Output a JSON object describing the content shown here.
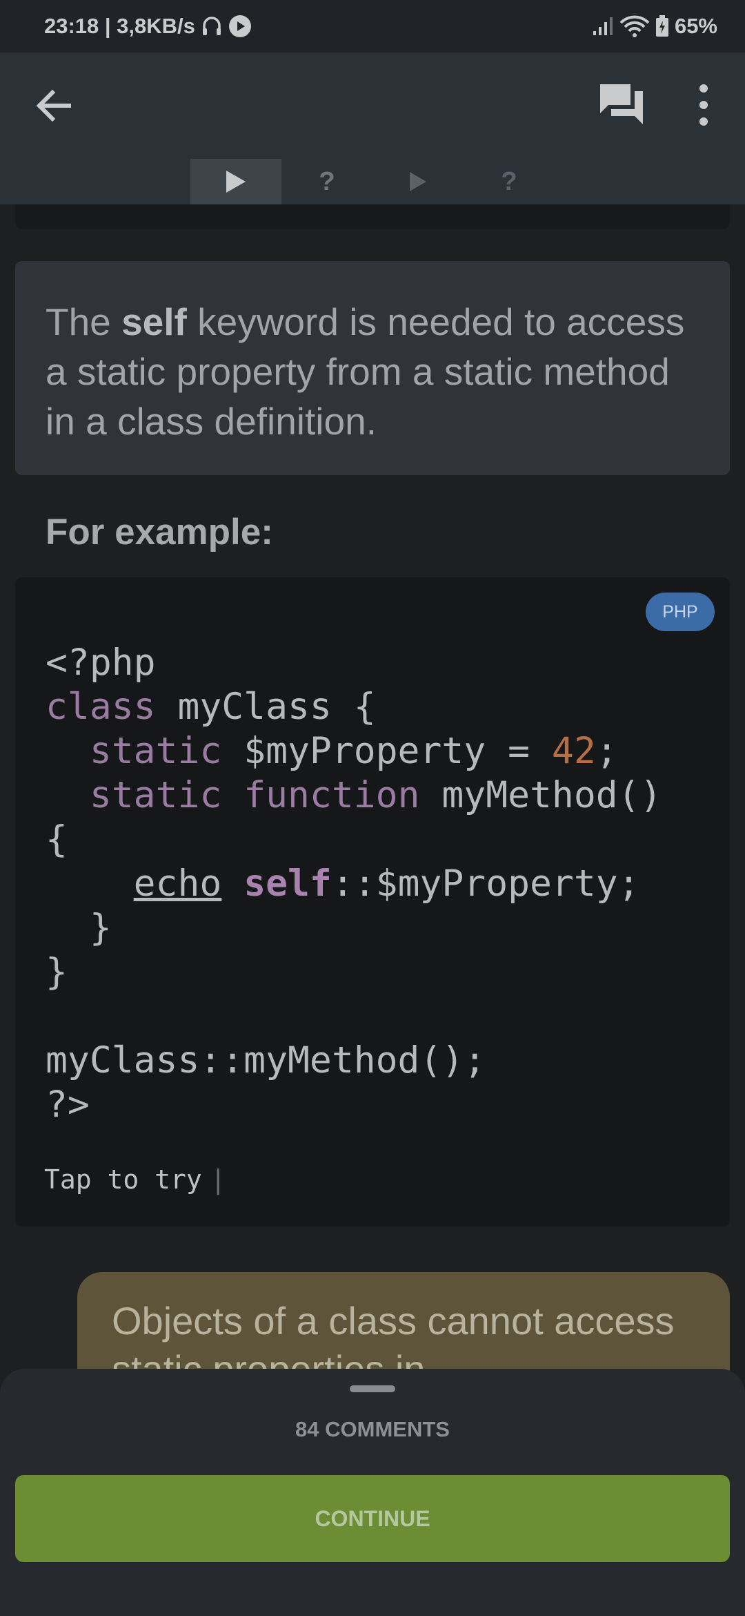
{
  "status_bar": {
    "time_speed": "23:18 | 3,8KB/s",
    "battery": "65%"
  },
  "app_bar": {
    "back_icon": "arrow-back-icon",
    "comments_icon": "chat-bubbles-icon",
    "more_icon": "more-vert-icon"
  },
  "tabs": [
    {
      "icon": "play-icon",
      "label": "",
      "active": true
    },
    {
      "icon": "question-icon",
      "label": "?",
      "active": false
    },
    {
      "icon": "play-icon",
      "label": "",
      "active": false
    },
    {
      "icon": "question-icon",
      "label": "?",
      "active": false
    }
  ],
  "lesson": {
    "info_pre": "The ",
    "info_bold": "self",
    "info_post": " keyword is needed to access a static property from a static method in a class definition.",
    "section_title": "For example:"
  },
  "code": {
    "language": "PHP",
    "line1": "<?php",
    "l2_kw": "class",
    "l2_rest": " myClass {",
    "l3_indent": "  ",
    "l3_kw": "static",
    "l3_mid": " $myProperty = ",
    "l3_num": "42",
    "l3_end": ";",
    "l4_indent": "  ",
    "l4_kw1": "static",
    "l4_sp": " ",
    "l4_kw2": "function",
    "l4_rest": " myMethod()",
    "line5": "{",
    "l6_indent": "    ",
    "l6_echo": "echo",
    "l6_sp": " ",
    "l6_self": "self",
    "l6_rest": "::$myProperty;",
    "line7": "  }",
    "line8": "}",
    "line9": "",
    "line10": "myClass::myMethod();",
    "line11": "?>",
    "tap_to_try": "Tap to try"
  },
  "answer": {
    "text": "Objects of a class cannot access static properties in"
  },
  "bottom_sheet": {
    "comments": "84 COMMENTS",
    "continue_label": "CONTINUE"
  },
  "colors": {
    "accent_green": "#6c8d34",
    "badge_blue": "#3c6ca7",
    "keyword_purple": "#9a7ba2",
    "number_orange": "#b76e43"
  }
}
